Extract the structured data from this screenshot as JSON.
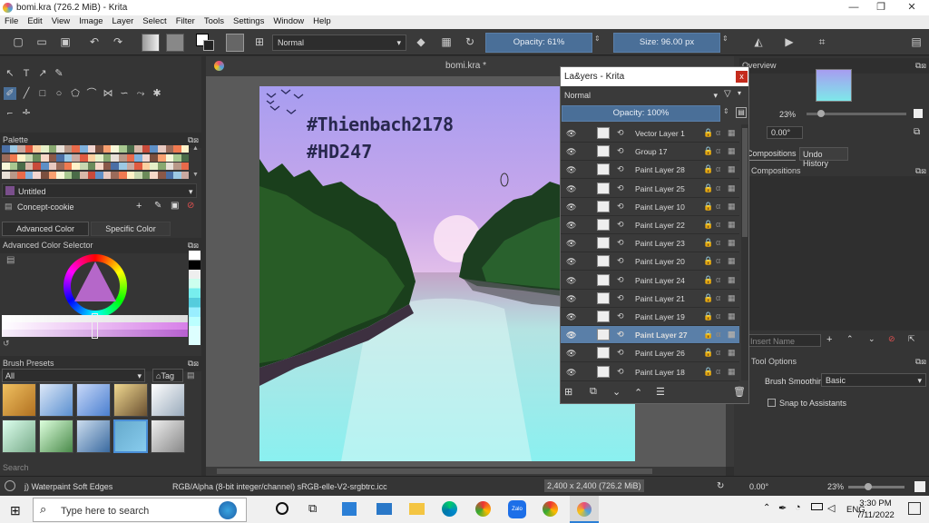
{
  "window": {
    "title": "bomi.kra (726.2 MiB)  - Krita",
    "minimize": "—",
    "maximize": "❐",
    "close": "✕"
  },
  "menu": [
    "File",
    "Edit",
    "View",
    "Image",
    "Layer",
    "Select",
    "Filter",
    "Tools",
    "Settings",
    "Window",
    "Help"
  ],
  "toolbar": {
    "blend_mode": "Normal",
    "opacity": "Opacity: 61%",
    "size": "Size: 96.00 px"
  },
  "left": {
    "palette_title": "Palette",
    "palette_name": "Untitled",
    "resource": "Concept-cookie",
    "tab_advanced": "Advanced Color Selector",
    "tab_specific": "Specific Color Selector",
    "adv_title": "Advanced Color Selector",
    "brush_title": "Brush Presets",
    "brush_filter": "All",
    "tag_label": "Tag",
    "search_placeholder": "Search"
  },
  "canvas": {
    "tab_title": "bomi.kra *",
    "text1": "#Thienbach2178",
    "text2": "#HD247"
  },
  "layers": {
    "title": "La&yers - Krita",
    "blend": "Normal",
    "opacity": "Opacity:  100%",
    "items": [
      {
        "name": "Vector Layer 1",
        "selected": false
      },
      {
        "name": "Group 17",
        "selected": false
      },
      {
        "name": "Paint Layer 28",
        "selected": false
      },
      {
        "name": "Paint Layer 25",
        "selected": false
      },
      {
        "name": "Paint Layer 10",
        "selected": false
      },
      {
        "name": "Paint Layer 22",
        "selected": false
      },
      {
        "name": "Paint Layer 23",
        "selected": false
      },
      {
        "name": "Paint Layer 20",
        "selected": false
      },
      {
        "name": "Paint Layer 24",
        "selected": false
      },
      {
        "name": "Paint Layer 21",
        "selected": false
      },
      {
        "name": "Paint Layer 19",
        "selected": false
      },
      {
        "name": "Paint Layer 27",
        "selected": true
      },
      {
        "name": "Paint Layer 26",
        "selected": false
      },
      {
        "name": "Paint Layer 18",
        "selected": false
      }
    ]
  },
  "right": {
    "overview": "Overview",
    "zoom": "23%",
    "rotation": "0.00°",
    "tab_compositions": "Compositions",
    "tab_undo": "Undo History",
    "comp_header": "Compositions",
    "name_placeholder": "Insert Name",
    "tool_options": "Tool Options",
    "smoothing_label": "Brush Smoothing:",
    "smoothing_value": "Basic",
    "snap": "Snap to Assistants"
  },
  "status": {
    "brush": "j) Waterpaint Soft Edges",
    "colorspace": "RGB/Alpha (8-bit integer/channel)  sRGB-elle-V2-srgbtrc.icc",
    "dims": "2,400 x 2,400 (726.2 MiB)",
    "rotation": "0.00°",
    "zoom": "23%"
  },
  "taskbar": {
    "search_placeholder": "Type here to search",
    "lang": "ENG",
    "time": "3:30 PM",
    "date": "7/11/2022"
  }
}
